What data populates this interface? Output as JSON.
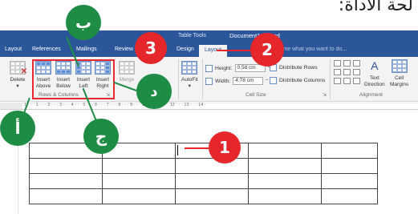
{
  "top_text": "لحة الأداة:",
  "titlebar": {
    "tools_label": "Table Tools",
    "doc_title": "Document1 - Word"
  },
  "tabs": {
    "layout_left": "Layout",
    "references": "References",
    "mailings": "Mailings",
    "review": "Review",
    "design": "Design",
    "layout_active": "Layout",
    "tell_me": "Tell me what you want to do..."
  },
  "ribbon": {
    "delete": "Delete",
    "insert_above": [
      "Insert",
      "Above"
    ],
    "insert_below": [
      "Insert",
      "Below"
    ],
    "insert_left": [
      "Insert",
      "Left"
    ],
    "insert_right": [
      "Insert",
      "Right"
    ],
    "merge": "Merge",
    "rows_columns_label": "Rows & Columns",
    "autofit": "AutoFit",
    "height_label": "Height:",
    "height_value": "0.58 cm",
    "width_label": "Width:",
    "width_value": "4.78 cm",
    "distribute_rows": "Distribute Rows",
    "distribute_columns": "Distribute Columns",
    "cell_size_label": "Cell Size",
    "text_direction": [
      "Text",
      "Direction"
    ],
    "cell_margins": [
      "Cell",
      "Margins"
    ],
    "alignment_label": "Alignment"
  },
  "ruler": "1 · · · 1 · · · 2 · · · 3 · · · 4 · · · 5 · · · 6 · · · 7 · · · 8 · · · 9 · · · 10 · · · 11 · · · 12 · · · 13 · · · 14 ·",
  "callouts": {
    "n1": "1",
    "n2": "2",
    "n3": "3",
    "alef": "أ",
    "beh": "ب",
    "jeem": "ج",
    "dal": "د"
  },
  "colors": {
    "word_blue": "#2b579a",
    "callout_red": "#e5262b",
    "callout_green": "#1e8c45"
  }
}
